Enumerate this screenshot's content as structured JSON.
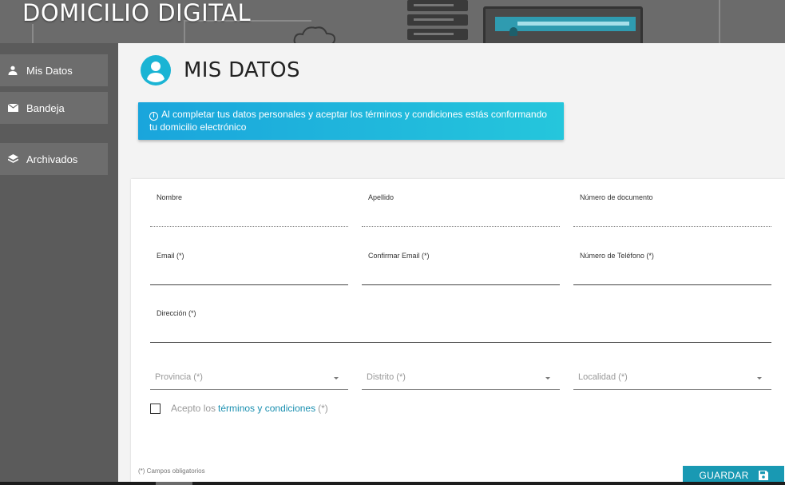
{
  "header": {
    "title": "DOMICILIO DIGITAL"
  },
  "sidebar": {
    "items": [
      {
        "label": "Mis Datos",
        "icon": "person-icon"
      },
      {
        "label": "Bandeja",
        "icon": "envelope-icon"
      },
      {
        "label": "Archivados",
        "icon": "layers-icon"
      }
    ]
  },
  "main": {
    "title": "MIS DATOS",
    "title_icon": "account-circle-icon",
    "info": "Al completar tus datos personales y aceptar los términos y condiciones estás conformando tu domicilio electrónico"
  },
  "form": {
    "nombre": {
      "label": "Nombre",
      "value": ""
    },
    "apellido": {
      "label": "Apellido",
      "value": ""
    },
    "documento": {
      "label": "Número de documento",
      "value": ""
    },
    "email": {
      "label": "Email (*)",
      "value": ""
    },
    "confirmar_email": {
      "label": "Confirmar Email (*)",
      "value": ""
    },
    "telefono": {
      "label": "Número de Teléfono (*)",
      "value": ""
    },
    "direccion": {
      "label": "Dirección (*)",
      "value": ""
    },
    "provincia": {
      "placeholder": "Provincia (*)"
    },
    "distrito": {
      "placeholder": "Distrito (*)"
    },
    "localidad": {
      "placeholder": "Localidad (*)"
    },
    "terms": {
      "prefix": "Acepto los",
      "link": "términos y condiciones",
      "suffix": "(*)"
    },
    "required_note": "(*) Campos obligatorios",
    "save_label": "GUARDAR"
  },
  "colors": {
    "accent": "#1999b3",
    "info_start": "#1aa5dc",
    "info_end": "#25c6dc",
    "sidebar": "#5b5b5b"
  }
}
